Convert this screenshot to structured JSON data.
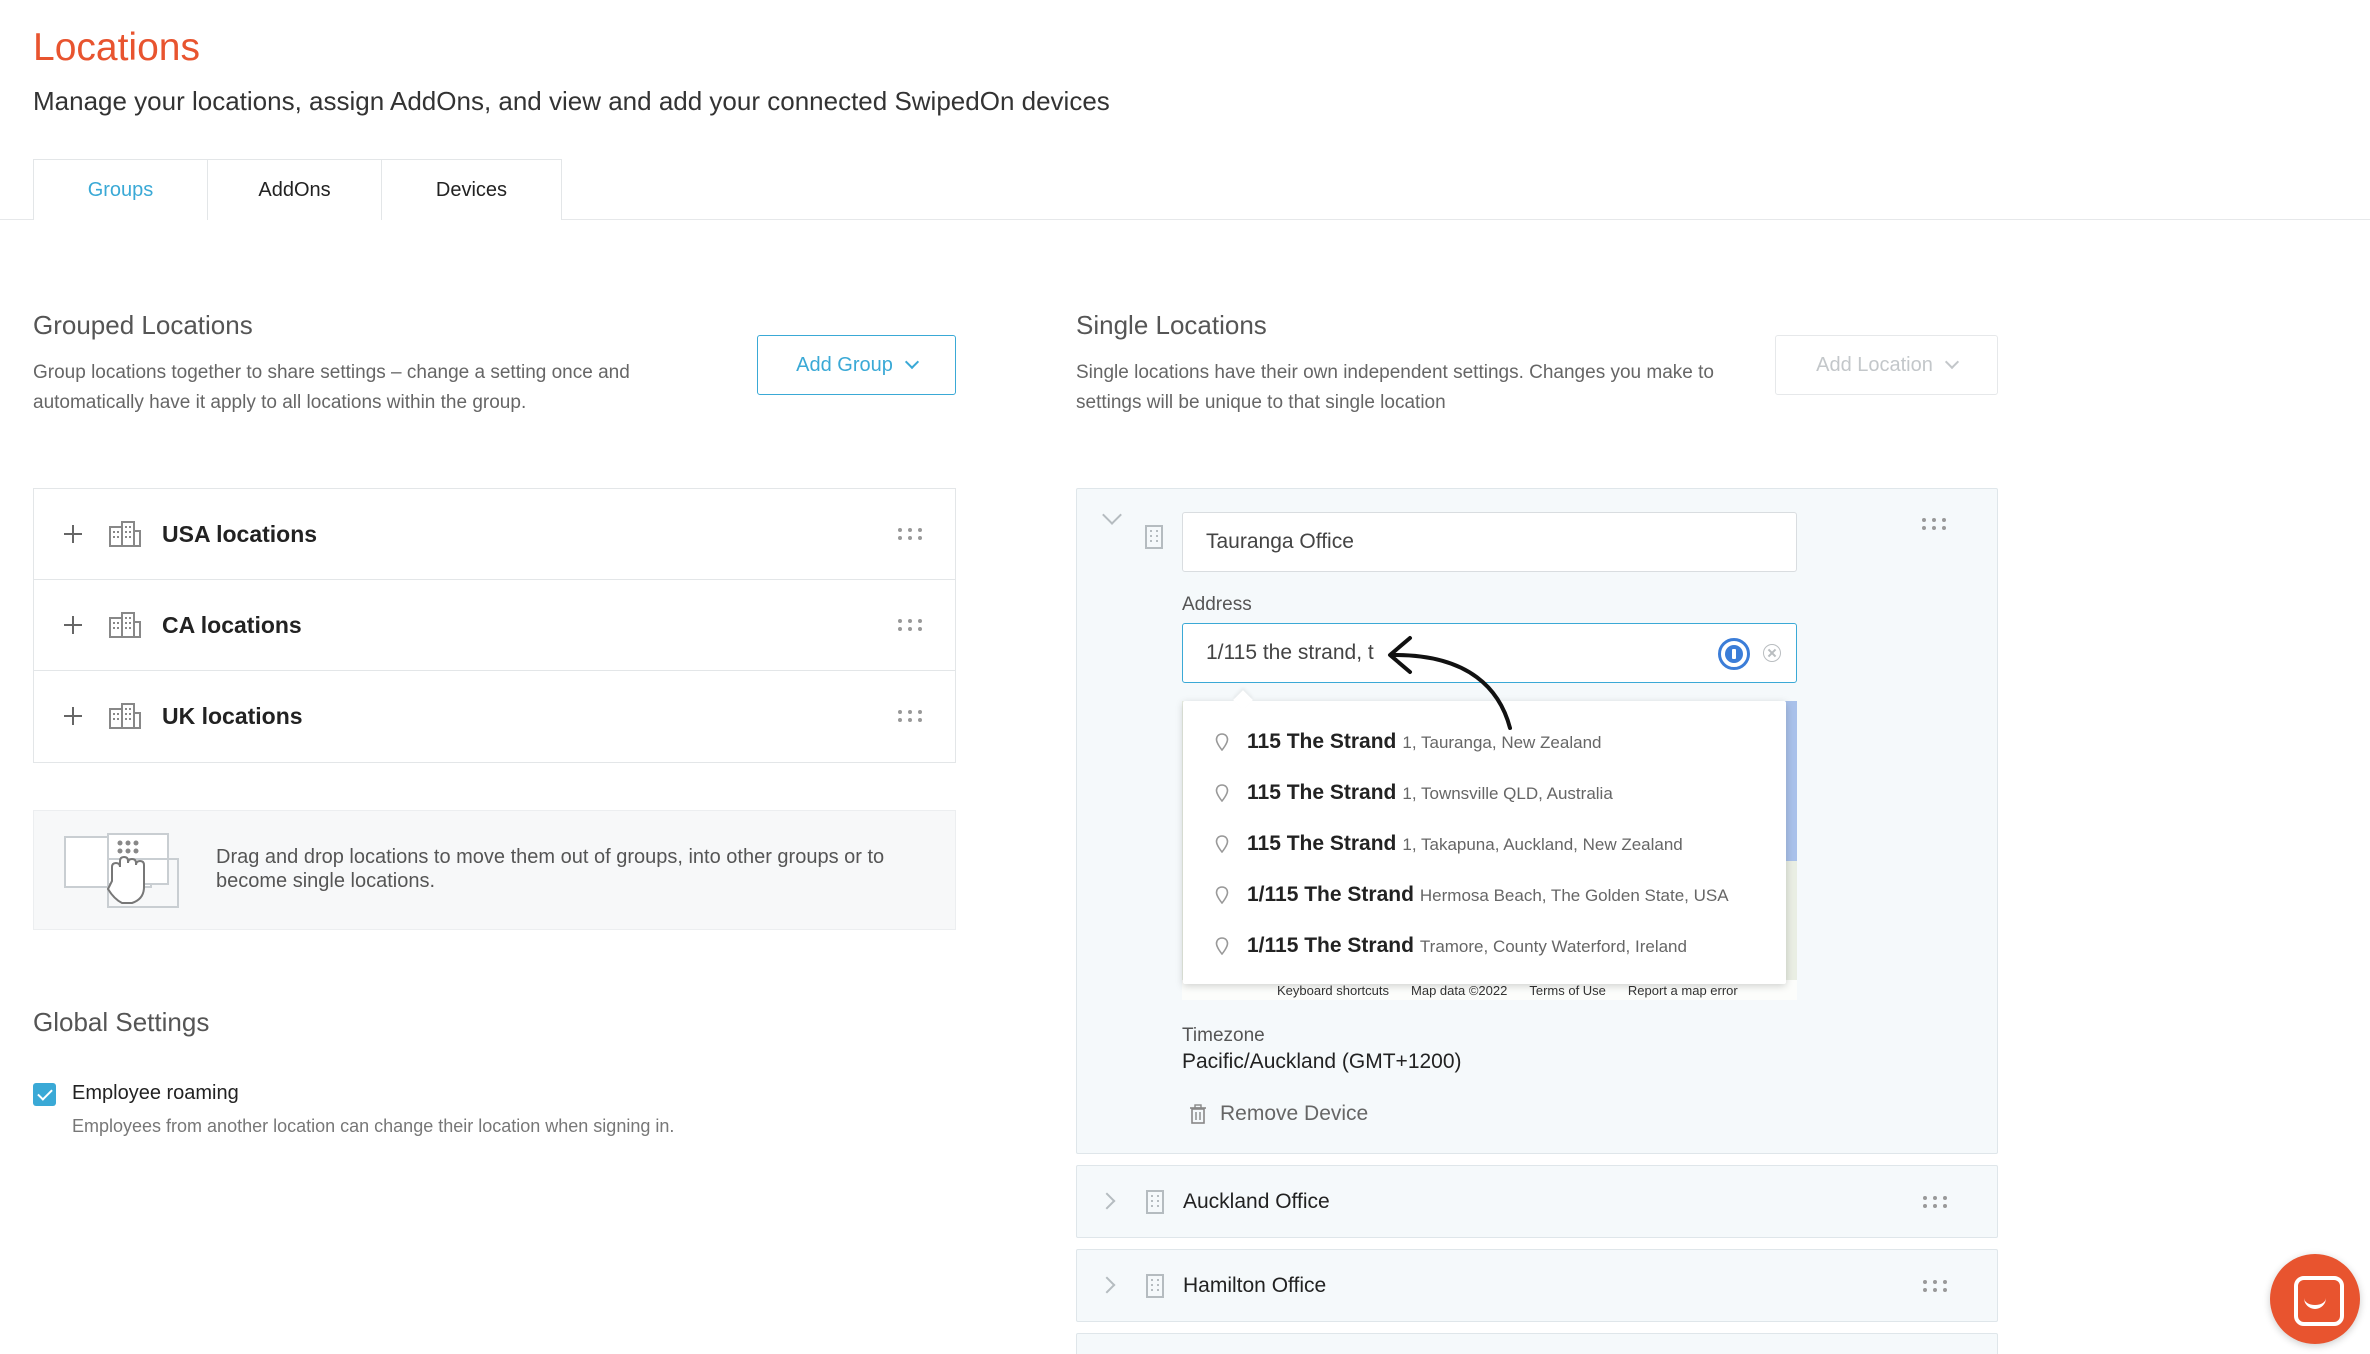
{
  "page": {
    "title": "Locations",
    "subtitle": "Manage your locations, assign AddOns, and view and add your connected SwipedOn devices"
  },
  "tabs": [
    {
      "label": "Groups",
      "active": true
    },
    {
      "label": "AddOns",
      "active": false
    },
    {
      "label": "Devices",
      "active": false
    }
  ],
  "grouped": {
    "title": "Grouped Locations",
    "description_line1": "Group locations together to share settings – change a setting once and",
    "description_line2": "automatically have it apply to all locations within the group.",
    "add_button": "Add Group",
    "groups": [
      {
        "name": "USA locations"
      },
      {
        "name": "CA locations"
      },
      {
        "name": "UK locations"
      }
    ],
    "dnd_hint_line1": "Drag and drop locations to move them out of groups, into other groups or to",
    "dnd_hint_line2": "become single locations."
  },
  "global_settings": {
    "title": "Global Settings",
    "employee_roaming": {
      "label": "Employee roaming",
      "checked": true,
      "help": "Employees from another location can change their location when signing in."
    }
  },
  "single": {
    "title": "Single Locations",
    "description_line1": "Single locations have their own independent settings. Changes you make to",
    "description_line2": "settings will be unique to that single location",
    "add_button": "Add Location",
    "expanded_location": {
      "name_value": "Tauranga Office",
      "address_label": "Address",
      "address_value": "1/115 the strand, t",
      "suggestions": [
        {
          "main": "115 The Strand",
          "sub": "1, Tauranga, New Zealand"
        },
        {
          "main": "115 The Strand",
          "sub": "1, Townsville QLD, Australia"
        },
        {
          "main": "115 The Strand",
          "sub": "1, Takapuna, Auckland, New Zealand"
        },
        {
          "main": "1/115 The Strand",
          "sub": "Hermosa Beach, The Golden State, USA"
        },
        {
          "main": "1/115 The Strand",
          "sub": "Tramore, County Waterford, Ireland"
        }
      ],
      "map_footer": {
        "shortcuts": "Keyboard shortcuts",
        "map_data": "Map data ©2022",
        "terms": "Terms of Use",
        "report": "Report a map error"
      },
      "timezone_label": "Timezone",
      "timezone_value": "Pacific/Auckland (GMT+1200)",
      "remove_device": "Remove Device"
    },
    "other_locations": [
      {
        "name": "Auckland Office"
      },
      {
        "name": "Hamilton Office"
      }
    ]
  },
  "colors": {
    "brand_orange": "#e8542f",
    "accent_blue": "#3aa9d6"
  }
}
